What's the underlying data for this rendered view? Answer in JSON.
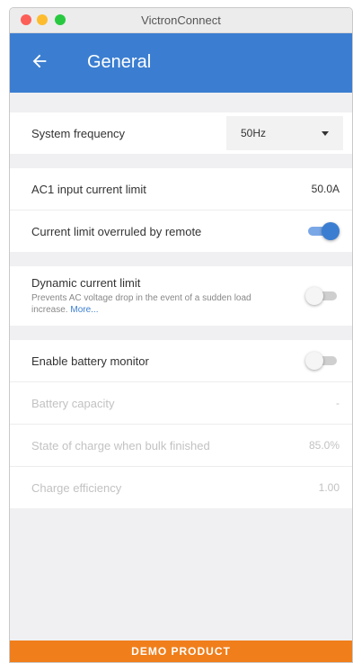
{
  "window": {
    "title": "VictronConnect"
  },
  "appbar": {
    "title": "General"
  },
  "group1": {
    "system_frequency": {
      "label": "System frequency",
      "value": "50Hz"
    }
  },
  "group2": {
    "ac1_limit": {
      "label": "AC1 input current limit",
      "value": "50.0A"
    },
    "overruled": {
      "label": "Current limit overruled by remote",
      "state": "on"
    }
  },
  "group3": {
    "dynamic": {
      "label": "Dynamic current limit",
      "description": "Prevents AC voltage drop in the event of a sudden load increase.",
      "more": "More...",
      "state": "off"
    }
  },
  "group4": {
    "battery_monitor": {
      "label": "Enable battery monitor",
      "state": "off"
    },
    "battery_capacity": {
      "label": "Battery capacity",
      "value": "-"
    },
    "soc_bulk": {
      "label": "State of charge when bulk finished",
      "value": "85.0%"
    },
    "charge_eff": {
      "label": "Charge efficiency",
      "value": "1.00"
    }
  },
  "footer": {
    "label": "DEMO PRODUCT"
  },
  "colors": {
    "accent": "#3b7ed1",
    "footer": "#f07e1a"
  }
}
